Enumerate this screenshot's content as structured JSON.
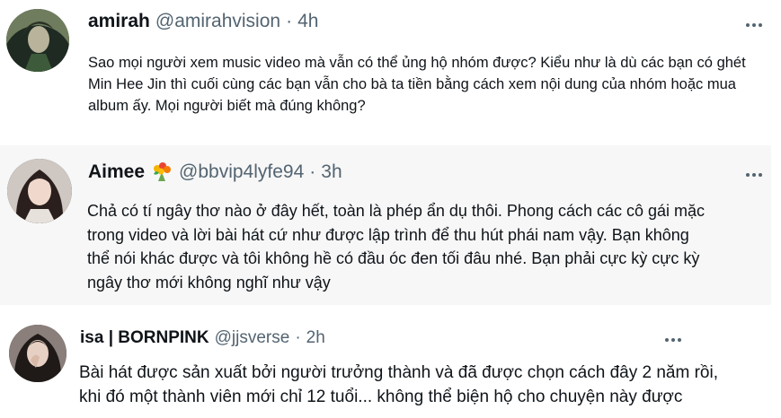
{
  "tweets": [
    {
      "name": "amirah",
      "handle": "@amirahvision",
      "separator": "·",
      "time": "4h",
      "body_lines": [
        "Sao mọi người xem music video mà vẫn có thể ủng hộ nhóm được? Kiểu như là dù các bạn có ghét",
        "Min Hee Jin thì cuối cùng các bạn vẫn cho bà ta tiền bằng cách xem nội dung của nhóm hoặc mua",
        "album ấy. Mọi người biết mà đúng không?"
      ]
    },
    {
      "name": "Aimee",
      "emoji_icon": "bouquet-icon",
      "handle": "@bbvip4lyfe94",
      "separator": "·",
      "time": "3h",
      "body_lines": [
        "Chả có tí ngây thơ nào ở đây hết, toàn là phép ẩn dụ thôi. Phong cách các cô gái mặc",
        "trong video và lời bài hát cứ như được lập trình để thu hút phái nam vậy. Bạn không",
        "thể nói khác được và tôi không hề có đầu óc đen tối đâu nhé. Bạn phải cực kỳ cực kỳ",
        "ngây thơ mới không nghĩ như vậy"
      ]
    },
    {
      "name": "isa | BORNPINK",
      "handle": "@jjsverse",
      "separator": "·",
      "time": "2h",
      "body_lines": [
        "Bài hát được sản xuất bởi người trưởng thành và đã được chọn cách đây 2 năm rồi,",
        "khi đó một thành viên mới chỉ 12 tuổi... không thể biện hộ cho chuyện này được"
      ]
    }
  ],
  "colors": {
    "text": "#0f1419",
    "secondary": "#536471",
    "highlight_bg": "#f7f7f7"
  }
}
